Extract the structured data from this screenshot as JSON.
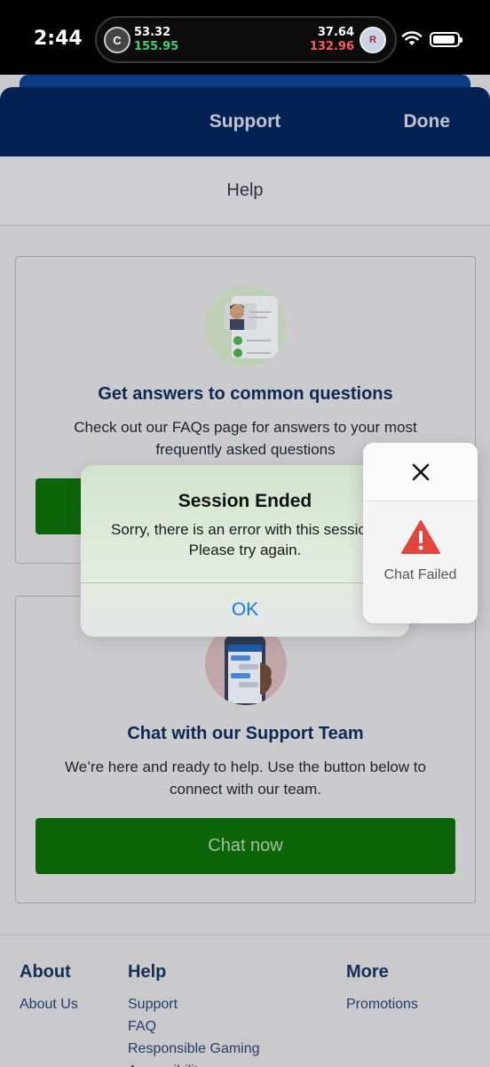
{
  "status_bar": {
    "time": "2:44",
    "live_activity": {
      "left_team_badge": "C",
      "left_score_top": "53.32",
      "left_score_bottom": "155.95",
      "right_score_top": "37.64",
      "right_score_bottom": "132.96",
      "right_team_badge": "R"
    }
  },
  "header": {
    "title": "Support",
    "done_label": "Done"
  },
  "help_bar": {
    "label": "Help"
  },
  "faq_card": {
    "title": "Get answers to common questions",
    "text": "Check out our FAQs page for answers to your most frequently asked questions",
    "button_label": ""
  },
  "chat_card": {
    "title": "Chat with our Support Team",
    "text": "We’re here and ready to help. Use the button below to connect with our team.",
    "button_label": "Chat now"
  },
  "footer": {
    "columns": [
      {
        "heading": "About",
        "links": [
          "About Us"
        ]
      },
      {
        "heading": "Help",
        "links": [
          "Support",
          "FAQ",
          "Responsible Gaming",
          "Accessibility"
        ]
      },
      {
        "heading": "More",
        "links": [
          "Promotions"
        ]
      }
    ]
  },
  "alert": {
    "title": "Session Ended",
    "message": "Sorry, there is an error with this session. Please try again.",
    "ok_label": "OK"
  },
  "chat_panel": {
    "status_label": "Chat Failed",
    "close_icon": "close-icon",
    "warning_icon": "warning-triangle-icon"
  },
  "colors": {
    "header_bg": "#042357",
    "button_green": "#0e6a0b",
    "alert_link": "#1677e6",
    "warning_red": "#e2453c"
  }
}
